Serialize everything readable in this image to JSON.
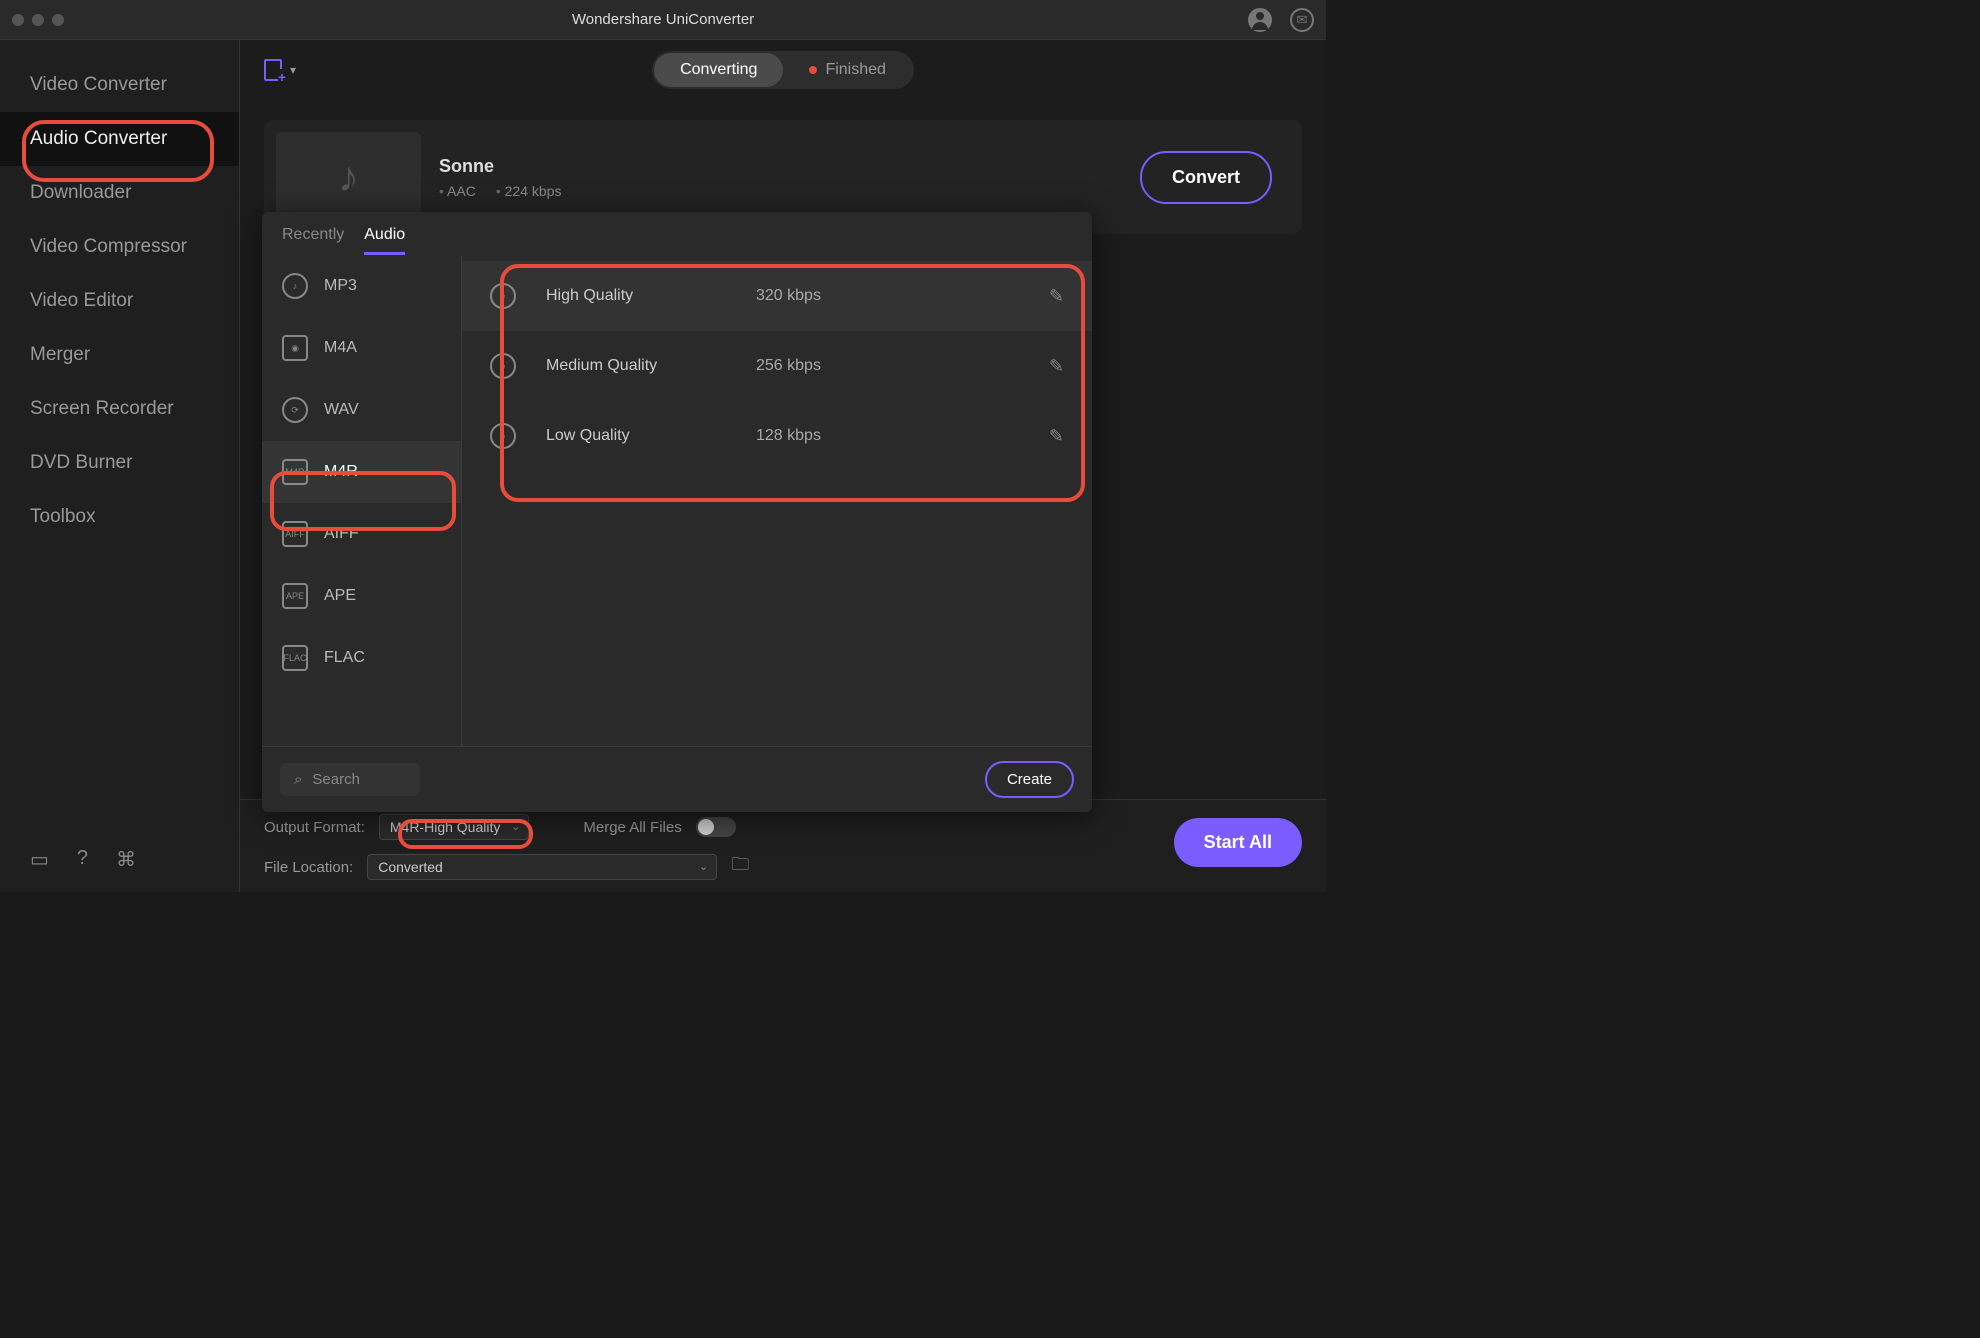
{
  "app": {
    "title": "Wondershare UniConverter"
  },
  "sidebar": {
    "items": [
      {
        "label": "Video Converter"
      },
      {
        "label": "Audio Converter"
      },
      {
        "label": "Downloader"
      },
      {
        "label": "Video Compressor"
      },
      {
        "label": "Video Editor"
      },
      {
        "label": "Merger"
      },
      {
        "label": "Screen Recorder"
      },
      {
        "label": "DVD Burner"
      },
      {
        "label": "Toolbox"
      }
    ],
    "active_index": 1
  },
  "segmented": {
    "converting": "Converting",
    "finished": "Finished"
  },
  "file": {
    "title": "Sonne",
    "codec": "AAC",
    "bitrate": "224 kbps",
    "convert_label": "Convert"
  },
  "format_popup": {
    "tabs": {
      "recently": "Recently",
      "audio": "Audio"
    },
    "formats": [
      {
        "label": "MP3"
      },
      {
        "label": "M4A"
      },
      {
        "label": "WAV"
      },
      {
        "label": "M4R"
      },
      {
        "label": "AIFF"
      },
      {
        "label": "APE"
      },
      {
        "label": "FLAC"
      }
    ],
    "selected_format_index": 3,
    "qualities": [
      {
        "name": "High Quality",
        "bitrate": "320 kbps"
      },
      {
        "name": "Medium Quality",
        "bitrate": "256 kbps"
      },
      {
        "name": "Low Quality",
        "bitrate": "128 kbps"
      }
    ],
    "search_placeholder": "Search",
    "create_label": "Create"
  },
  "bottom": {
    "output_format_label": "Output Format:",
    "output_format_value": "M4R-High Quality",
    "merge_label": "Merge All Files",
    "file_location_label": "File Location:",
    "file_location_value": "Converted",
    "start_all_label": "Start All"
  }
}
